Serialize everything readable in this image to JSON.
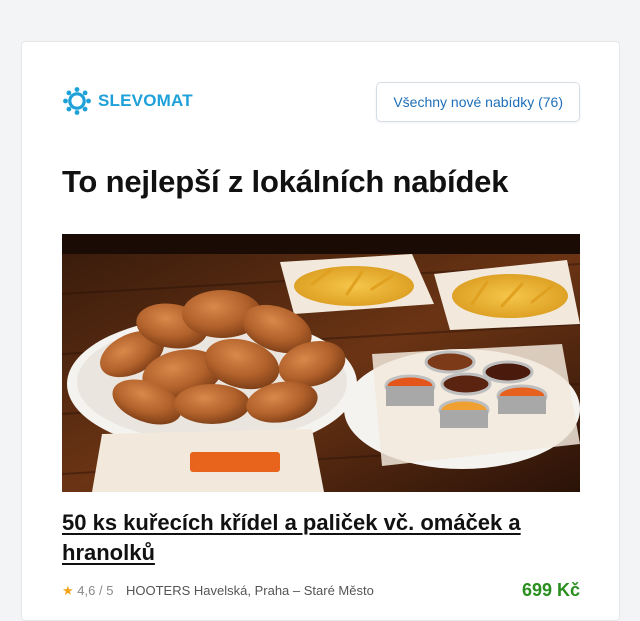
{
  "brand": {
    "name": "SLEVOMAT",
    "color": "#1ea1d9",
    "icon": "gear-logo-icon"
  },
  "header": {
    "all_offers_label": "Všechny nové nabídky (76)"
  },
  "section": {
    "title": "To nejlepší z lokálních nabídek"
  },
  "deal": {
    "image_icon": "chicken-wings-photo",
    "title": "50 ks kuřecích křídel a paliček vč. omáček a hranolků",
    "star_icon": "★",
    "rating": "4,6 / 5",
    "merchant": "HOOTERS Havelská, Praha – Staré Město",
    "price": "699 Kč",
    "price_color": "#2a8f1f"
  }
}
